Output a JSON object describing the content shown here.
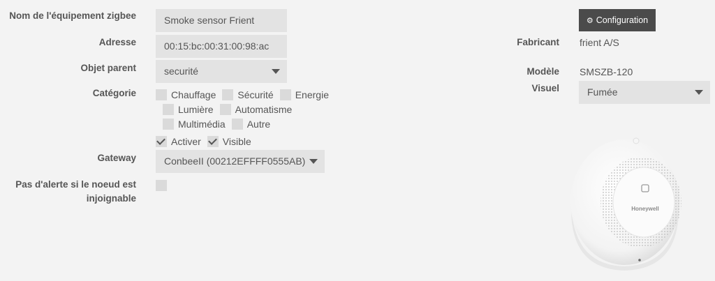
{
  "left_labels": {
    "name": "Nom de l'équipement zigbee",
    "address": "Adresse",
    "parent": "Objet parent",
    "category": "Catégorie",
    "gateway": "Gateway",
    "no_alert_line1": "Pas d'alerte si le noeud est",
    "no_alert_line2": "injoignable"
  },
  "fields": {
    "name_value": "Smoke sensor Frient",
    "address_value": "00:15:bc:00:31:00:98:ac",
    "parent_value": "securité",
    "gateway_value": "ConbeeII (00212EFFFF0555AB)"
  },
  "categories": {
    "row1": [
      "Chauffage",
      "Sécurité",
      "Energie"
    ],
    "row2": [
      "Lumière",
      "Automatisme"
    ],
    "row3": [
      "Multimédia",
      "Autre"
    ]
  },
  "flags": {
    "activate_label": "Activer",
    "visible_label": "Visible"
  },
  "right": {
    "config_button": "Configuration",
    "manufacturer_label": "Fabricant",
    "manufacturer_value": "frient A/S",
    "model_label": "Modèle",
    "model_value": "SMSZB-120",
    "visual_label": "Visuel",
    "visual_value": "Fumée"
  },
  "device_image": {
    "brand_logo_text": "Honeywell",
    "icon": "smoke-detector-image"
  },
  "icons": {
    "config": "gears-icon",
    "dropdown": "caret-down-icon",
    "check": "check-icon"
  }
}
